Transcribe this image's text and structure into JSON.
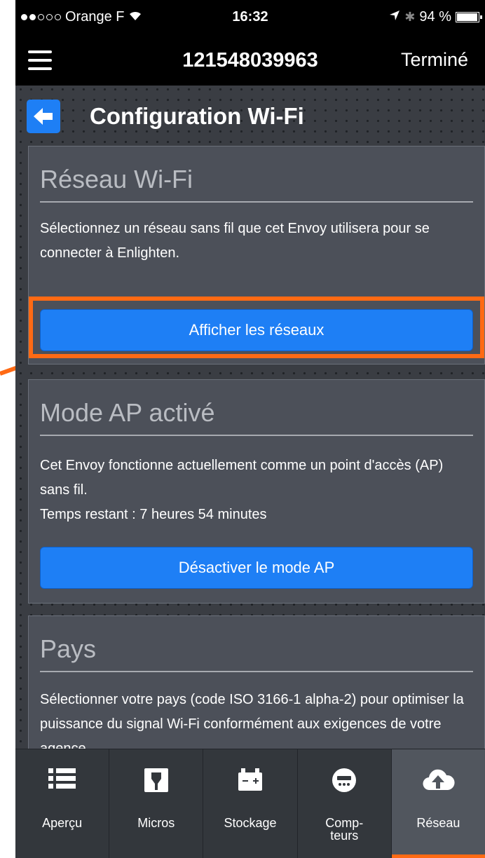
{
  "status_bar": {
    "carrier": "Orange F",
    "time": "16:32",
    "battery": "94 %"
  },
  "nav": {
    "title": "121548039963",
    "done_label": "Terminé"
  },
  "page": {
    "title": "Configuration Wi-Fi"
  },
  "wifi_card": {
    "title": "Réseau Wi-Fi",
    "description": "Sélectionnez un réseau sans fil que cet Envoy utilisera pour se connecter à Enlighten.",
    "button_label": "Afficher les réseaux"
  },
  "ap_card": {
    "title": "Mode AP activé",
    "description": "Cet Envoy fonctionne actuellement comme un point d'accès (AP) sans fil.",
    "time_remaining": "Temps restant : 7 heures 54 minutes",
    "button_label": "Désactiver le mode AP"
  },
  "country_card": {
    "title": "Pays",
    "description": "Sélectionner votre pays (code ISO 3166-1 alpha-2) pour optimiser la puissance du signal Wi-Fi conformément aux exigences de votre agence"
  },
  "tabs": [
    {
      "label": "Aperçu",
      "icon": "list-icon",
      "active": false
    },
    {
      "label": "Micros",
      "icon": "microinverter-icon",
      "active": false
    },
    {
      "label": "Stockage",
      "icon": "battery-storage-icon",
      "active": false
    },
    {
      "label_line1": "Comp-",
      "label_line2": "teurs",
      "icon": "meter-icon",
      "active": false
    },
    {
      "label": "Réseau",
      "icon": "cloud-upload-icon",
      "active": true
    }
  ],
  "colors": {
    "accent": "#1e7ff5",
    "highlight": "#ff6a14",
    "active_tab_indicator": "#ff6a14"
  }
}
